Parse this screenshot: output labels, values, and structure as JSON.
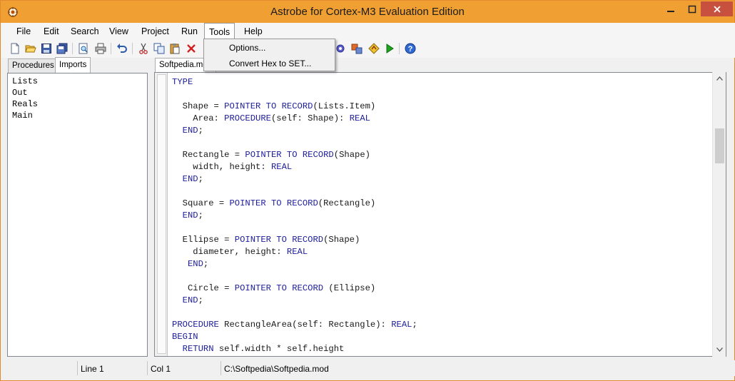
{
  "window": {
    "title": "Astrobe for Cortex-M3 Evaluation Edition"
  },
  "menu": [
    "File",
    "Edit",
    "Search",
    "View",
    "Project",
    "Run",
    "Tools",
    "Help"
  ],
  "tools_menu": [
    "Options...",
    "Convert Hex to SET..."
  ],
  "left_tabs": [
    "Procedures",
    "Imports"
  ],
  "imports": [
    "Lists",
    "Out",
    "Reals",
    "Main"
  ],
  "editor": {
    "tab_label": "Softpedia.mod",
    "lines": [
      [
        [
          "kw",
          "TYPE"
        ]
      ],
      [],
      [
        [
          "tx",
          "  Shape = "
        ],
        [
          "kw",
          "POINTER TO RECORD"
        ],
        [
          "tx",
          "(Lists.Item)"
        ]
      ],
      [
        [
          "tx",
          "    Area: "
        ],
        [
          "kw",
          "PROCEDURE"
        ],
        [
          "tx",
          "(self: Shape): "
        ],
        [
          "kw",
          "REAL"
        ]
      ],
      [
        [
          "kw",
          "  END"
        ],
        [
          "tx",
          ";"
        ]
      ],
      [],
      [
        [
          "tx",
          "  Rectangle = "
        ],
        [
          "kw",
          "POINTER TO RECORD"
        ],
        [
          "tx",
          "(Shape)"
        ]
      ],
      [
        [
          "tx",
          "    width, height: "
        ],
        [
          "kw",
          "REAL"
        ]
      ],
      [
        [
          "kw",
          "  END"
        ],
        [
          "tx",
          ";"
        ]
      ],
      [],
      [
        [
          "tx",
          "  Square = "
        ],
        [
          "kw",
          "POINTER TO RECORD"
        ],
        [
          "tx",
          "(Rectangle)"
        ]
      ],
      [
        [
          "kw",
          "  END"
        ],
        [
          "tx",
          ";"
        ]
      ],
      [],
      [
        [
          "tx",
          "  Ellipse = "
        ],
        [
          "kw",
          "POINTER TO RECORD"
        ],
        [
          "tx",
          "(Shape)"
        ]
      ],
      [
        [
          "tx",
          "    diameter, height: "
        ],
        [
          "kw",
          "REAL"
        ]
      ],
      [
        [
          "kw",
          "   END"
        ],
        [
          "tx",
          ";"
        ]
      ],
      [],
      [
        [
          "tx",
          "   Circle = "
        ],
        [
          "kw",
          "POINTER TO RECORD"
        ],
        [
          "tx",
          " (Ellipse)"
        ]
      ],
      [
        [
          "kw",
          "  END"
        ],
        [
          "tx",
          ";"
        ]
      ],
      [],
      [
        [
          "kw",
          "PROCEDURE"
        ],
        [
          "tx",
          " RectangleArea(self: Rectangle): "
        ],
        [
          "kw",
          "REAL"
        ],
        [
          "tx",
          ";"
        ]
      ],
      [
        [
          "kw",
          "BEGIN"
        ]
      ],
      [
        [
          "tx",
          "  "
        ],
        [
          "kw",
          "RETURN"
        ],
        [
          "tx",
          " self.width * self.height"
        ]
      ]
    ]
  },
  "status": {
    "line": "Line 1",
    "col": "Col 1",
    "path": "C:\\Softpedia\\Softpedia.mod"
  },
  "colors": {
    "titlebar": "#f0a032",
    "keyword": "#1d1d9b",
    "close_button": "#c7503f"
  }
}
